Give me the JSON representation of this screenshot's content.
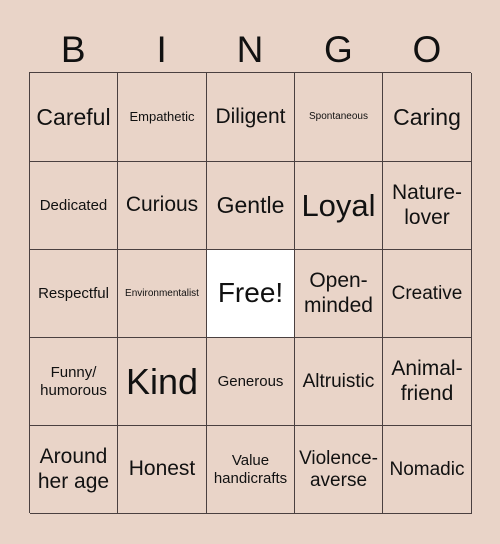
{
  "header": {
    "letters": [
      "B",
      "I",
      "N",
      "G",
      "O"
    ]
  },
  "colors": {
    "background": "#E9D4C8",
    "free_cell": "#FFFFFF",
    "grid_line": "#4A4040"
  },
  "card": {
    "rows": [
      [
        "Careful",
        "Empathetic",
        "Diligent",
        "Spontaneous",
        "Caring"
      ],
      [
        "Dedicated",
        "Curious",
        "Gentle",
        "Loyal",
        "Nature-lover"
      ],
      [
        "Respectful",
        "Environmentalist",
        "Free!",
        "Open-minded",
        "Creative"
      ],
      [
        "Funny/ humorous",
        "Kind",
        "Generous",
        "Altruistic",
        "Animal-friend"
      ],
      [
        "Around her age",
        "Honest",
        "Value handicrafts",
        "Violence-averse",
        "Nomadic"
      ]
    ]
  }
}
